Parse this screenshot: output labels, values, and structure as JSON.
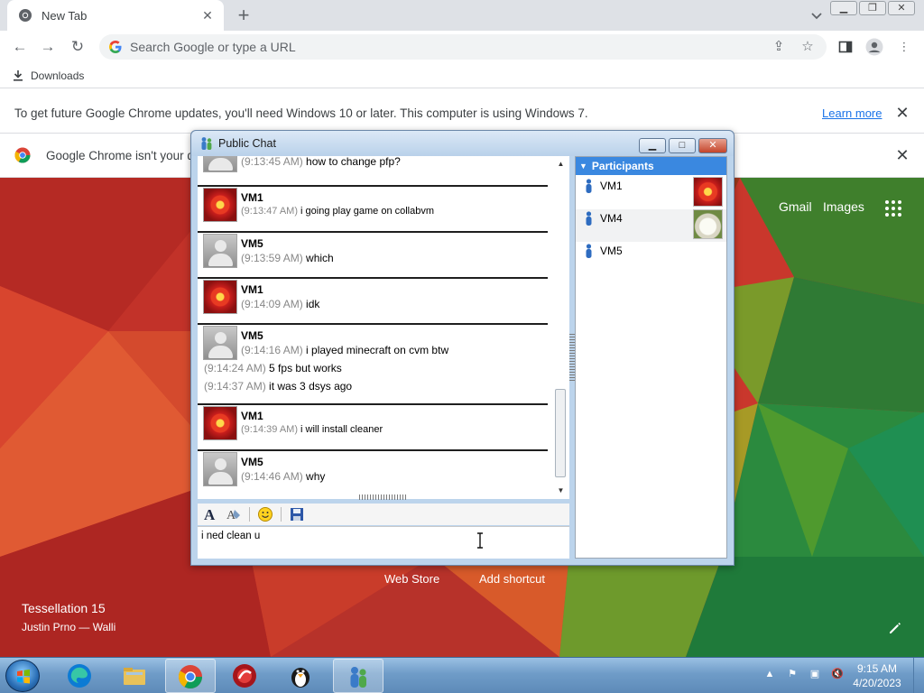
{
  "browser": {
    "tab": {
      "title": "New Tab"
    },
    "omnibox": {
      "placeholder": "Search Google or type a URL"
    },
    "bookmarks": [
      {
        "label": "Downloads",
        "icon": "download-icon"
      }
    ],
    "infobar_update": {
      "text": "To get future Google Chrome updates, you'll need Windows 10 or later. This computer is using Windows 7.",
      "link": "Learn more"
    },
    "infobar_default": {
      "text": "Google Chrome isn't your d"
    }
  },
  "ntp": {
    "links": {
      "gmail": "Gmail",
      "images": "Images"
    },
    "shortcuts": {
      "web_store": "Web Store",
      "add_shortcut": "Add shortcut"
    },
    "background": {
      "title": "Tessellation 15",
      "credit": "Justin Prno — Walli"
    }
  },
  "chat": {
    "title": "Public Chat",
    "messages": {
      "m0": {
        "time": "(9:13:45 AM)",
        "text": "how to change pfp?"
      },
      "m1": {
        "name": "VM1",
        "time": "(9:13:47 AM)",
        "text": "i going play game on collabvm"
      },
      "m2": {
        "name": "VM5",
        "time": "(9:13:59 AM)",
        "text": "which"
      },
      "m3": {
        "name": "VM1",
        "time": "(9:14:09 AM)",
        "text": "idk"
      },
      "m4": {
        "name": "VM5",
        "time": "(9:14:16 AM)",
        "text": "i played minecraft on cvm btw"
      },
      "m4b": {
        "time": "(9:14:24 AM)",
        "text": "5 fps but works"
      },
      "m4c": {
        "time": "(9:14:37 AM)",
        "text": "it was 3 dsys ago"
      },
      "m5": {
        "name": "VM1",
        "time": "(9:14:39 AM)",
        "text": "i will install cleaner"
      },
      "m6": {
        "name": "VM5",
        "time": "(9:14:46 AM)",
        "text": "why"
      }
    },
    "input_value": "i ned clean u",
    "participants_header": "Participants",
    "participants": [
      {
        "name": "VM1"
      },
      {
        "name": "VM4"
      },
      {
        "name": "VM5"
      }
    ]
  },
  "taskbar": {
    "clock_time": "9:15 AM",
    "clock_date": "4/20/2023"
  },
  "colors": {
    "chrome_blue": "#1a73e8",
    "participants_header": "#3a88e0",
    "timestamp": "#888888"
  }
}
